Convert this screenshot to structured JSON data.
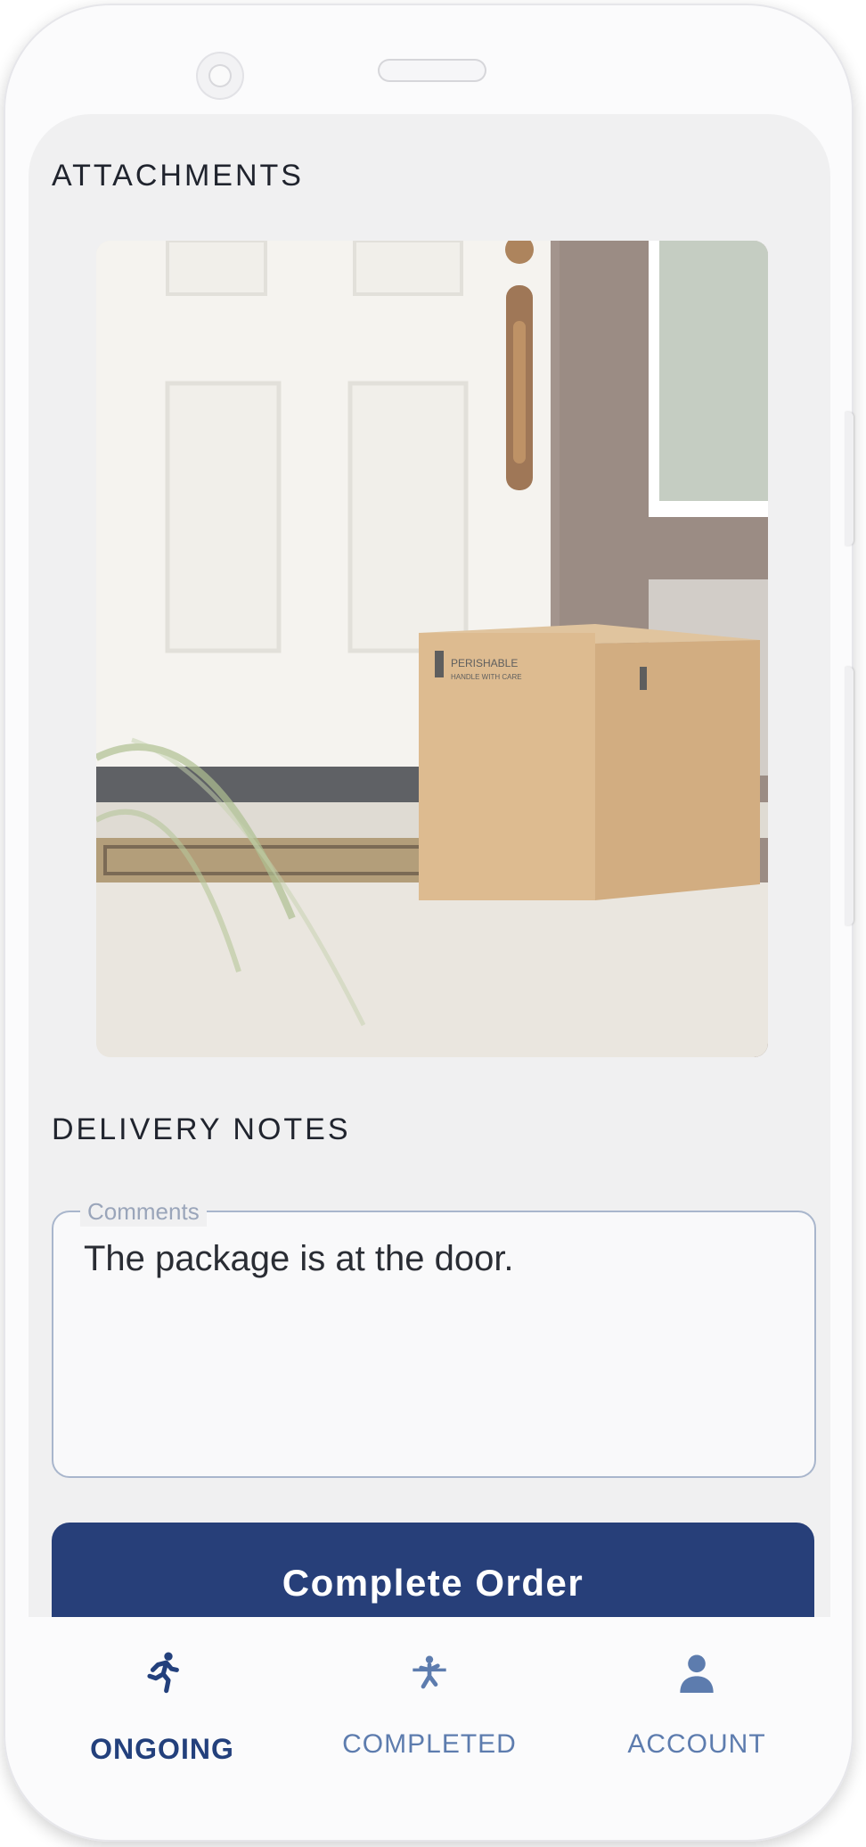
{
  "sections": {
    "attachments_title": "ATTACHMENTS",
    "notes_title": "DELIVERY NOTES"
  },
  "attachment": {
    "description_icon": "photo-package-at-door",
    "box_label": "PERISHABLE",
    "box_sublabel": "HANDLE WITH CARE"
  },
  "comments": {
    "label": "Comments",
    "value": "The package is at the door."
  },
  "actions": {
    "complete_label": "Complete Order"
  },
  "nav": {
    "items": [
      {
        "label": "ONGOING",
        "icon": "running-person-icon",
        "active": true
      },
      {
        "label": "COMPLETED",
        "icon": "finish-line-icon",
        "active": false
      },
      {
        "label": "ACCOUNT",
        "icon": "person-icon",
        "active": false
      }
    ]
  },
  "colors": {
    "primary": "#273f79",
    "nav_inactive": "#5d7cae",
    "background": "#f0f0f1"
  }
}
